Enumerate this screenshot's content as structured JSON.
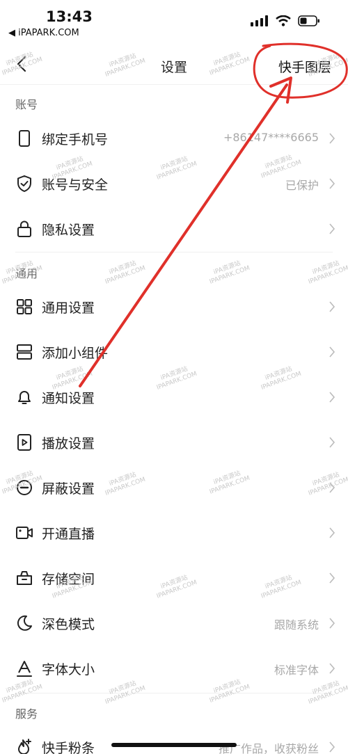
{
  "status_bar": {
    "time": "13:43",
    "back_app": "◀ iPAPARK.COM",
    "icons": [
      "signal-icon",
      "wifi-icon",
      "battery-icon"
    ]
  },
  "nav": {
    "title": "设置",
    "annotation": "快手图层"
  },
  "sections": {
    "account": {
      "header": "账号",
      "items": [
        {
          "icon": "phone-icon",
          "label": "绑定手机号",
          "value": "+86147****6665"
        },
        {
          "icon": "shield-icon",
          "label": "账号与安全",
          "value": "已保护"
        },
        {
          "icon": "lock-icon",
          "label": "隐私设置",
          "value": ""
        }
      ]
    },
    "general": {
      "header": "通用",
      "items": [
        {
          "icon": "grid-icon",
          "label": "通用设置",
          "value": ""
        },
        {
          "icon": "widget-icon",
          "label": "添加小组件",
          "value": ""
        },
        {
          "icon": "bell-icon",
          "label": "通知设置",
          "value": ""
        },
        {
          "icon": "play-icon",
          "label": "播放设置",
          "value": ""
        },
        {
          "icon": "block-icon",
          "label": "屏蔽设置",
          "value": ""
        },
        {
          "icon": "video-camera-icon",
          "label": "开通直播",
          "value": ""
        },
        {
          "icon": "storage-icon",
          "label": "存储空间",
          "value": ""
        },
        {
          "icon": "moon-icon",
          "label": "深色模式",
          "value": "跟随系统"
        },
        {
          "icon": "font-size-icon",
          "label": "字体大小",
          "value": "标准字体"
        }
      ]
    },
    "service": {
      "header": "服务",
      "items": [
        {
          "icon": "fan-strip-icon",
          "label": "快手粉条",
          "value": "推广作品，收获粉丝"
        }
      ]
    }
  },
  "watermark": {
    "line1": "iPA资源站",
    "line2": "IPAPARK.COM"
  },
  "colors": {
    "annotation_red": "#e0302a",
    "text_primary": "#222222",
    "text_secondary": "#a8a8a8",
    "section_header": "#666666"
  }
}
